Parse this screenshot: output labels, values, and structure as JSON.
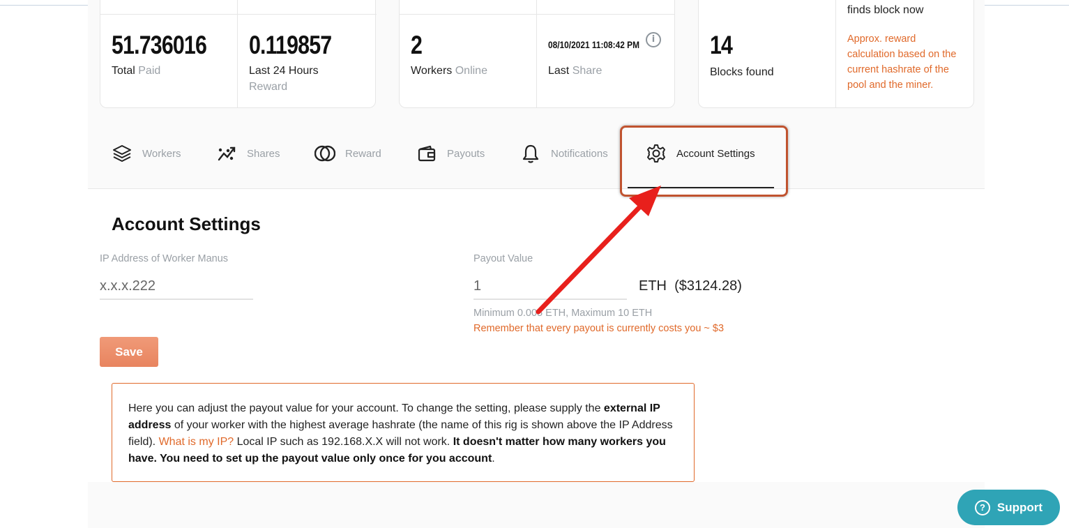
{
  "stats": {
    "total_paid_value": "51.736016",
    "total_paid_label": "Total",
    "total_paid_label_muted": "Paid",
    "last24_value": "0.119857",
    "last24_label": "Last 24 Hours",
    "last24_label_muted": "Reward",
    "workers_value": "2",
    "workers_label": "Workers",
    "workers_label_muted": "Online",
    "last_share_value": "08/10/2021 11:08:42 PM",
    "last_share_label": "Last",
    "last_share_label_muted": "Share",
    "blocks_value": "14",
    "blocks_label": "Blocks found",
    "finds_block_text": "finds block now",
    "approx_reward_text": "Approx. reward calculation based on the current hashrate of the pool and the miner."
  },
  "tabs": [
    {
      "label": "Workers",
      "icon": "layers-icon"
    },
    {
      "label": "Shares",
      "icon": "chart-trend-icon"
    },
    {
      "label": "Reward",
      "icon": "coins-icon"
    },
    {
      "label": "Payouts",
      "icon": "wallet-icon"
    },
    {
      "label": "Notifications",
      "icon": "bell-icon"
    },
    {
      "label": "Account Settings",
      "icon": "gear-icon",
      "active": true
    }
  ],
  "account": {
    "title": "Account Settings",
    "ip_label": "IP Address of Worker Manus",
    "ip_value": "x.x.x.222",
    "payout_label": "Payout Value",
    "payout_value": "1",
    "currency": "ETH",
    "usd_value": "($3124.28)",
    "hint": "Minimum 0.005 ETH, Maximum 10 ETH",
    "warning": "Remember that every payout is currently costs you ~ $3",
    "save_label": "Save"
  },
  "notice": {
    "p1": "Here you can adjust the payout value for your account. To change the setting, please supply the ",
    "b1": "external IP address",
    "p2": " of your worker with the highest average hashrate (the name of this rig is shown above the IP Address field). ",
    "link": "What is my IP?",
    "p3": " Local IP such as 192.168.X.X will not work. ",
    "b2": "It doesn't matter how many workers you have. You need to set up the payout value only once for you account",
    "p4": "."
  },
  "support": {
    "label": "Support"
  },
  "colors": {
    "accent": "#e0692a",
    "support": "#2fa4b6",
    "highlight": "#c0532f",
    "arrow": "#e8201c"
  }
}
